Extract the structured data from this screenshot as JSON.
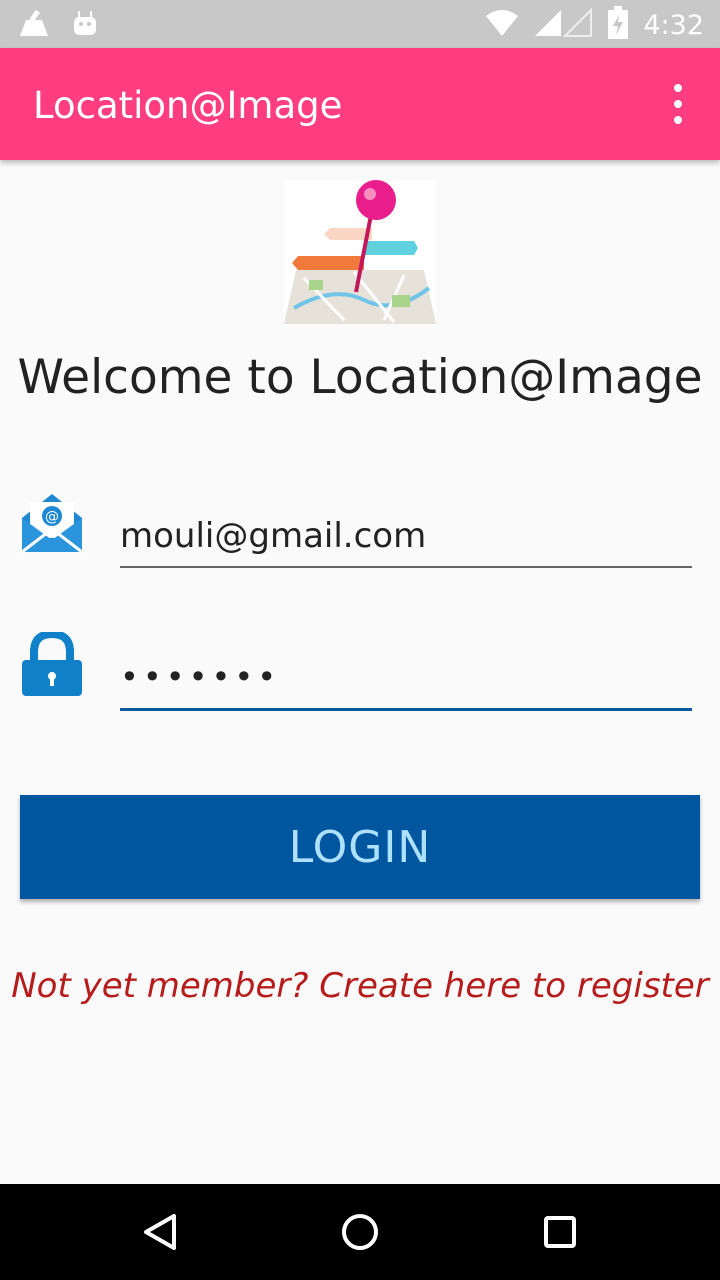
{
  "status_bar": {
    "time": "4:32"
  },
  "app_bar": {
    "title": "Location@Image"
  },
  "welcome": {
    "text": "Welcome to Location@Image"
  },
  "form": {
    "email_value": "mouli@gmail.com",
    "password_value": "•••••••",
    "login_label": "LOGIN",
    "register_text": "Not yet member? Create here to register"
  },
  "colors": {
    "app_bar": "#ff3d7f",
    "button": "#0057a0",
    "button_text": "#aee0ff",
    "link": "#b71c1c",
    "focus_underline": "#0a5aa0"
  },
  "icons": [
    "cleaner-icon",
    "android-icon",
    "wifi-icon",
    "signal-icon",
    "battery-icon",
    "more-vert-icon",
    "email-icon",
    "lock-icon",
    "back-icon",
    "home-icon",
    "recents-icon"
  ]
}
